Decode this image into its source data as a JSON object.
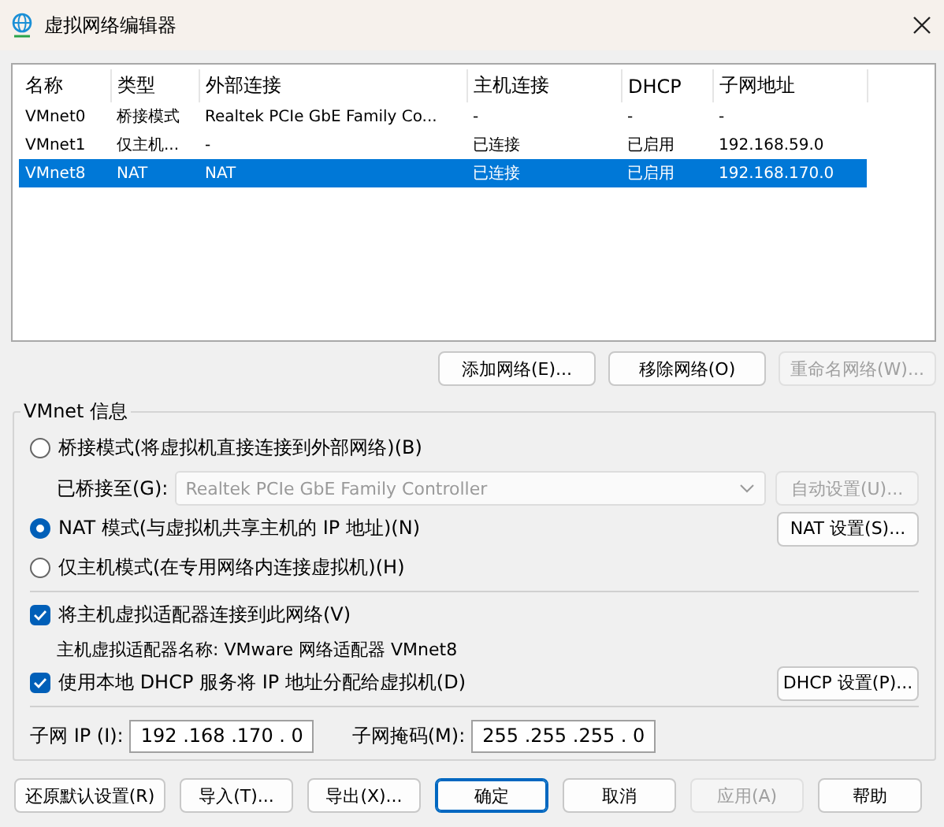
{
  "window": {
    "title": "虚拟网络编辑器"
  },
  "table": {
    "columns": [
      "名称",
      "类型",
      "外部连接",
      "主机连接",
      "DHCP",
      "子网地址"
    ],
    "rows": [
      {
        "cells": [
          "VMnet0",
          "桥接模式",
          "Realtek PCIe GbE Family Co...",
          "-",
          "-",
          "-"
        ],
        "selected": false
      },
      {
        "cells": [
          "VMnet1",
          "仅主机...",
          "-",
          "已连接",
          "已启用",
          "192.168.59.0"
        ],
        "selected": false
      },
      {
        "cells": [
          "VMnet8",
          "NAT",
          "NAT",
          "已连接",
          "已启用",
          "192.168.170.0"
        ],
        "selected": true
      }
    ]
  },
  "table_buttons": [
    {
      "label": "添加网络(E)...",
      "disabled": false
    },
    {
      "label": "移除网络(O)",
      "disabled": false
    },
    {
      "label": "重命名网络(W)...",
      "disabled": true
    }
  ],
  "vmnet_info": {
    "title": "VMnet 信息",
    "modes": [
      {
        "label": "桥接模式(将虚拟机直接连接到外部网络)(B)",
        "selected": false
      },
      {
        "label": "NAT 模式(与虚拟机共享主机的 IP 地址)(N)",
        "selected": true
      },
      {
        "label": "仅主机模式(在专用网络内连接虚拟机)(H)",
        "selected": false
      }
    ],
    "bridge": {
      "label": "已桥接至(G):",
      "value": "Realtek PCIe GbE Family Controller",
      "disabled": true,
      "button": {
        "label": "自动设置(U)...",
        "disabled": true
      }
    },
    "nat_button": {
      "label": "NAT 设置(S)...",
      "disabled": false
    },
    "host_adapter": {
      "label": "将主机虚拟适配器连接到此网络(V)",
      "checked": true
    },
    "adapter_name": "主机虚拟适配器名称: VMware 网络适配器 VMnet8",
    "dhcp": {
      "label": "使用本地 DHCP 服务将 IP 地址分配给虚拟机(D)",
      "checked": true
    },
    "dhcp_button": {
      "label": "DHCP 设置(P)...",
      "disabled": false
    },
    "subnet_ip": {
      "label": "子网 IP (I):",
      "value": "192 .168 .170 . 0"
    },
    "subnet_mask": {
      "label": "子网掩码(M):",
      "value": "255 .255 .255 . 0"
    }
  },
  "footer_buttons": [
    {
      "label": "还原默认设置(R)",
      "disabled": false,
      "primary": false
    },
    {
      "label": "导入(T)...",
      "disabled": false,
      "primary": false
    },
    {
      "label": "导出(X)...",
      "disabled": false,
      "primary": false
    },
    {
      "label": "确定",
      "disabled": false,
      "primary": true
    },
    {
      "label": "取消",
      "disabled": false,
      "primary": false
    },
    {
      "label": "应用(A)",
      "disabled": true,
      "primary": false
    },
    {
      "label": "帮助",
      "disabled": false,
      "primary": false
    }
  ]
}
